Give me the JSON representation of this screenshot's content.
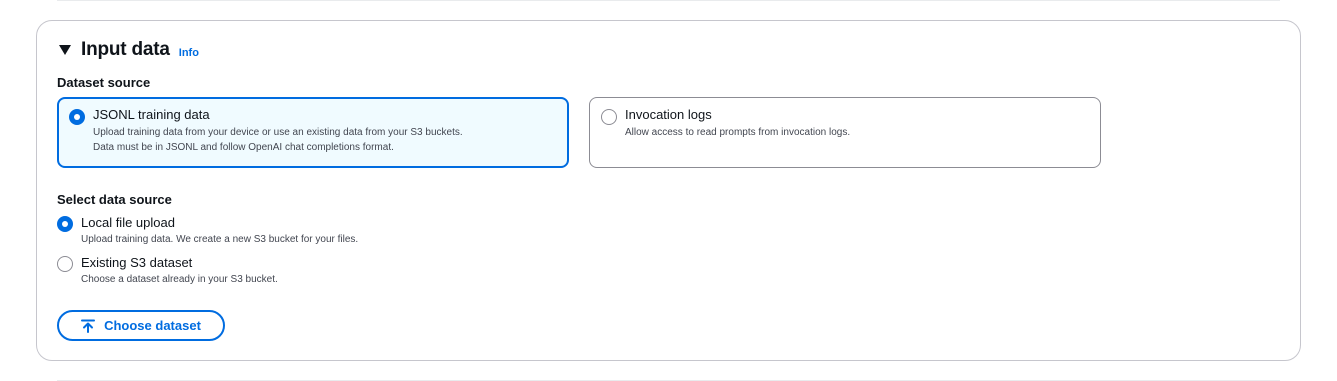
{
  "section": {
    "title": "Input data",
    "info_link": "Info"
  },
  "dataset_source": {
    "label": "Dataset source",
    "options": [
      {
        "title": "JSONL training data",
        "description_line1": "Upload training data from your device or use an existing data from your S3 buckets.",
        "description_line2": "Data must be in JSONL and follow OpenAI chat completions format.",
        "selected": true
      },
      {
        "title": "Invocation logs",
        "description_line1": "Allow access to read prompts from invocation logs.",
        "selected": false
      }
    ]
  },
  "data_source": {
    "label": "Select data source",
    "options": [
      {
        "title": "Local file upload",
        "description": "Upload training data. We create a new S3 bucket for your files.",
        "selected": true
      },
      {
        "title": "Existing S3 dataset",
        "description": "Choose a dataset already in your S3 bucket.",
        "selected": false
      }
    ]
  },
  "choose_button": {
    "label": "Choose dataset",
    "icon": "upload-icon"
  },
  "colors": {
    "accent": "#006ce0",
    "selected_bg": "#f0fbff",
    "border": "#c6c6cd",
    "text": "#0f141a",
    "secondary_text": "#424650"
  }
}
